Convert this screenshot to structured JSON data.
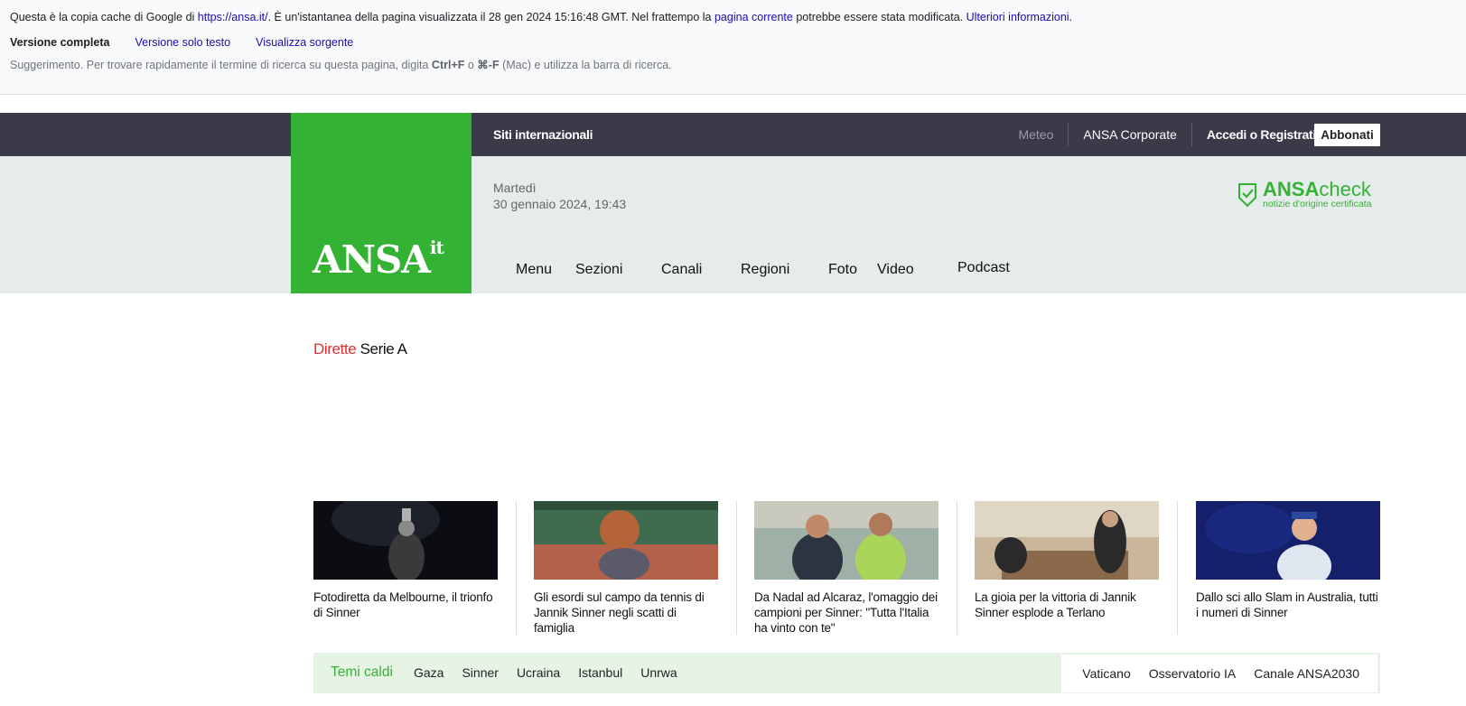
{
  "cache_banner": {
    "line1_prefix": "Questa è la copia cache di Google di ",
    "url": "https://ansa.it/",
    "line1_mid": ". È un'istantanea della pagina visualizzata il 28 gen 2024 15:16:48 GMT. Nel frattempo la ",
    "current_page_link": "pagina corrente",
    "line1_suffix": " potrebbe essere stata modificata. ",
    "more_info": "Ulteriori informazioni.",
    "links": {
      "full": "Versione completa",
      "text_only": "Versione solo testo",
      "source": "Visualizza sorgente"
    },
    "tip_prefix": "Suggerimento. Per trovare rapidamente il termine di ricerca su questa pagina, digita ",
    "tip_key1": "Ctrl+F",
    "tip_or": " o ",
    "tip_key2": "⌘-F",
    "tip_suffix": " (Mac) e utilizza la barra di ricerca."
  },
  "header": {
    "logo": "ANSA",
    "logo_suffix": "it",
    "siti": "Siti internazionali",
    "topnav": {
      "meteo": "Meteo",
      "corporate": "ANSA Corporate",
      "login": "Accedi o Registrati",
      "subscribe": "Abbonati"
    },
    "date_day": "Martedì",
    "date_full": "30 gennaio 2024, 19:43",
    "ansacheck_main": "ANSA",
    "ansacheck_check": "check",
    "ansacheck_sub": "notizie d'origine certificata",
    "nav": [
      "Menu",
      "Sezioni",
      "Canali",
      "Regioni",
      "Foto",
      "Video",
      "Podcast"
    ]
  },
  "dirette": {
    "label": "Dirette",
    "topic": "Serie A"
  },
  "cards": [
    {
      "title": "Fotodiretta da Melbourne, il trionfo di Sinner"
    },
    {
      "title": "Gli esordi sul campo da tennis di Jannik Sinner negli scatti di famiglia"
    },
    {
      "title": "Da Nadal ad Alcaraz, l'omaggio dei campioni per Sinner: \"Tutta l'Italia ha vinto con te\""
    },
    {
      "title": "La gioia per la vittoria di Jannik Sinner esplode a Terlano"
    },
    {
      "title": "Dallo sci allo Slam in Australia, tutti i numeri di Sinner"
    }
  ],
  "temi_caldi": {
    "label": "Temi caldi",
    "items": [
      "Gaza",
      "Sinner",
      "Ucraina",
      "Istanbul",
      "Unrwa"
    ],
    "right_items": [
      "Vaticano",
      "Osservatorio IA",
      "Canale ANSA2030"
    ]
  },
  "colors": {
    "ansa_green": "#34b233",
    "topbar": "#3a3a48",
    "subbar": "#e6ecec",
    "dirette_red": "#e03131"
  }
}
